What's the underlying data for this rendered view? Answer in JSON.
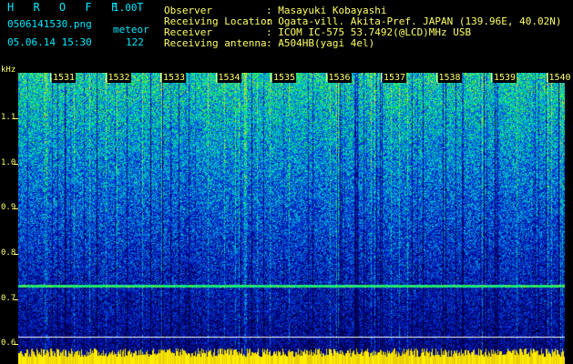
{
  "app": {
    "title": "H R O F F T",
    "version": "1.00"
  },
  "file": {
    "name": "0506141530.png",
    "datetime": "05.06.14 15:30"
  },
  "meteor": {
    "label": "meteor",
    "count": "122"
  },
  "info": {
    "observer_label": "Observer",
    "observer_value": ": Masayuki Kobayashi",
    "location_label": "Receiving Location",
    "location_value": ": Ogata-vill. Akita-Pref. JAPAN (139.96E, 40.02N)",
    "receiver_label": "Receiver",
    "receiver_value": ": ICOM IC-575 53.7492(@LCD)MHz USB",
    "antenna_label": "Receiving antenna",
    "antenna_value": ": A504HB(yagi 4el)"
  },
  "axis": {
    "unit": "kHz",
    "ticks": [
      "1.1",
      "1.0",
      "0.9",
      "0.8",
      "0.7",
      "0.6"
    ]
  },
  "time_labels": [
    "1531",
    "1532",
    "1533",
    "1534",
    "1535",
    "1536",
    "1537",
    "1538",
    "1539",
    "1540"
  ],
  "colors": {
    "label": "#ffff66",
    "header": "#00e8ff",
    "background": "#000000"
  }
}
